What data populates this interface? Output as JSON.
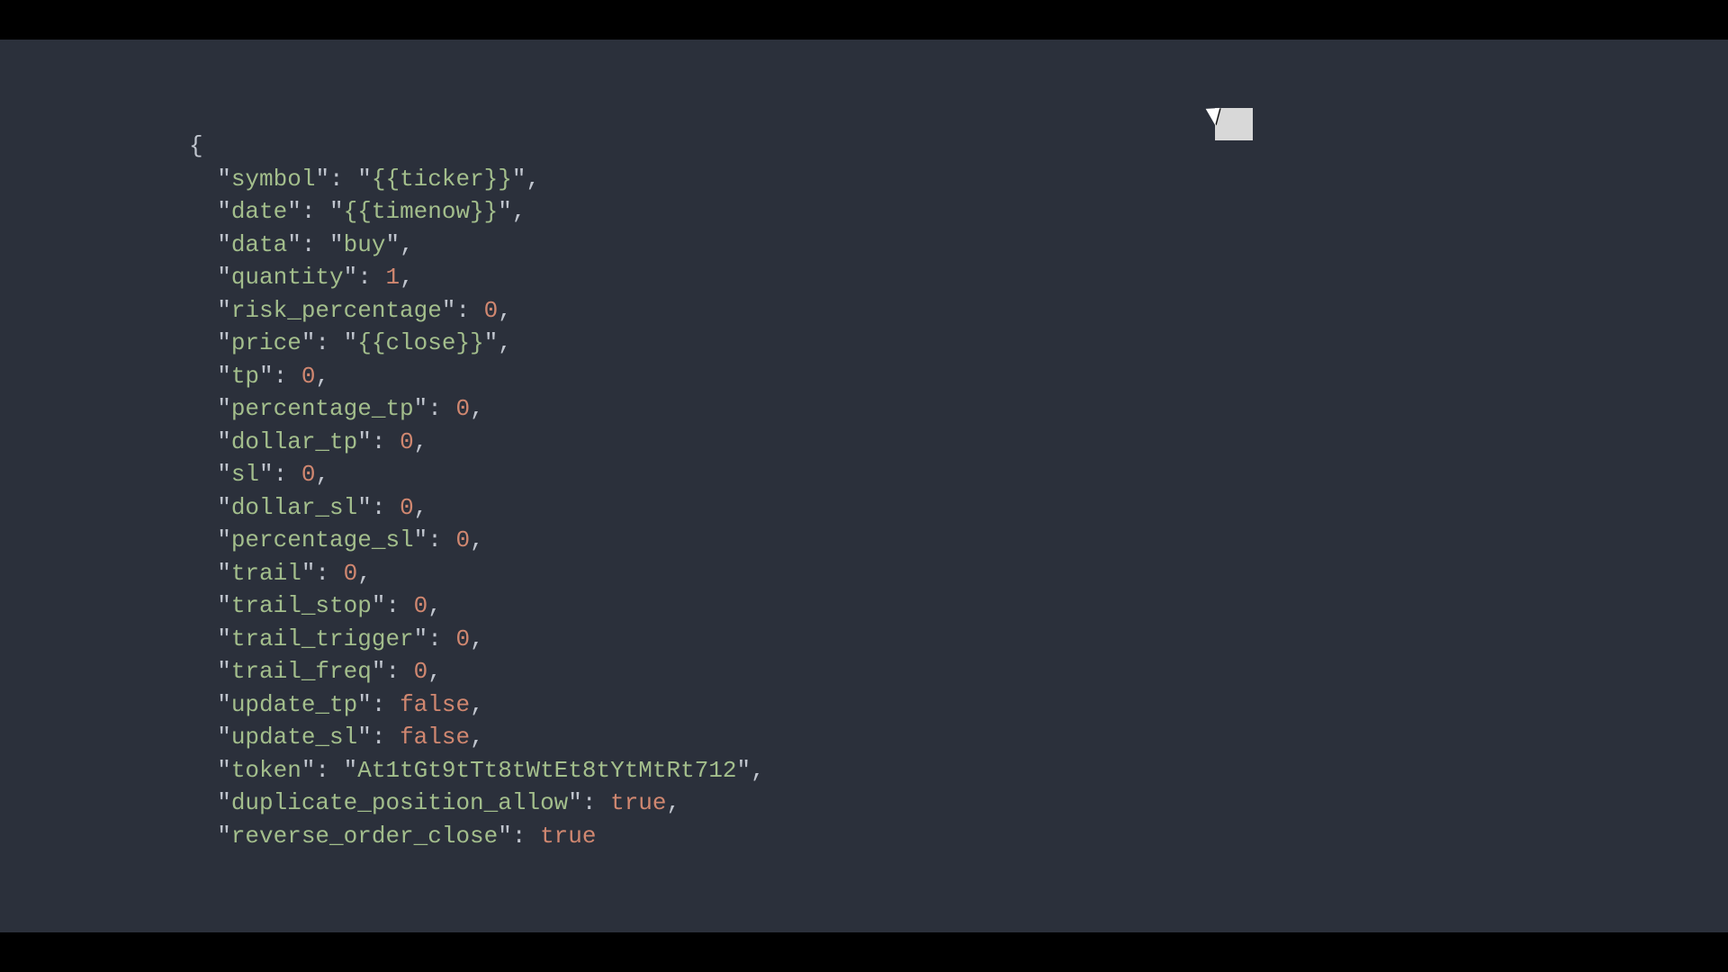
{
  "code": {
    "lines": [
      [
        {
          "t": "punct",
          "v": "{"
        }
      ],
      [
        {
          "t": "punct",
          "v": "  \""
        },
        {
          "t": "key",
          "v": "symbol"
        },
        {
          "t": "punct",
          "v": "\": \""
        },
        {
          "t": "str",
          "v": "{{ticker}}"
        },
        {
          "t": "punct",
          "v": "\","
        }
      ],
      [
        {
          "t": "punct",
          "v": "  \""
        },
        {
          "t": "key",
          "v": "date"
        },
        {
          "t": "punct",
          "v": "\": \""
        },
        {
          "t": "str",
          "v": "{{timenow}}"
        },
        {
          "t": "punct",
          "v": "\","
        }
      ],
      [
        {
          "t": "punct",
          "v": "  \""
        },
        {
          "t": "key",
          "v": "data"
        },
        {
          "t": "punct",
          "v": "\": \""
        },
        {
          "t": "str",
          "v": "buy"
        },
        {
          "t": "punct",
          "v": "\","
        }
      ],
      [
        {
          "t": "punct",
          "v": "  \""
        },
        {
          "t": "key",
          "v": "quantity"
        },
        {
          "t": "punct",
          "v": "\": "
        },
        {
          "t": "num",
          "v": "1"
        },
        {
          "t": "punct",
          "v": ","
        }
      ],
      [
        {
          "t": "punct",
          "v": "  \""
        },
        {
          "t": "key",
          "v": "risk_percentage"
        },
        {
          "t": "punct",
          "v": "\": "
        },
        {
          "t": "num",
          "v": "0"
        },
        {
          "t": "punct",
          "v": ","
        }
      ],
      [
        {
          "t": "punct",
          "v": "  \""
        },
        {
          "t": "key",
          "v": "price"
        },
        {
          "t": "punct",
          "v": "\": \""
        },
        {
          "t": "str",
          "v": "{{close}}"
        },
        {
          "t": "punct",
          "v": "\","
        }
      ],
      [
        {
          "t": "punct",
          "v": "  \""
        },
        {
          "t": "key",
          "v": "tp"
        },
        {
          "t": "punct",
          "v": "\": "
        },
        {
          "t": "num",
          "v": "0"
        },
        {
          "t": "punct",
          "v": ","
        }
      ],
      [
        {
          "t": "punct",
          "v": "  \""
        },
        {
          "t": "key",
          "v": "percentage_tp"
        },
        {
          "t": "punct",
          "v": "\": "
        },
        {
          "t": "num",
          "v": "0"
        },
        {
          "t": "punct",
          "v": ","
        }
      ],
      [
        {
          "t": "punct",
          "v": "  \""
        },
        {
          "t": "key",
          "v": "dollar_tp"
        },
        {
          "t": "punct",
          "v": "\": "
        },
        {
          "t": "num",
          "v": "0"
        },
        {
          "t": "punct",
          "v": ","
        }
      ],
      [
        {
          "t": "punct",
          "v": "  \""
        },
        {
          "t": "key",
          "v": "sl"
        },
        {
          "t": "punct",
          "v": "\": "
        },
        {
          "t": "num",
          "v": "0"
        },
        {
          "t": "punct",
          "v": ","
        }
      ],
      [
        {
          "t": "punct",
          "v": "  \""
        },
        {
          "t": "key",
          "v": "dollar_sl"
        },
        {
          "t": "punct",
          "v": "\": "
        },
        {
          "t": "num",
          "v": "0"
        },
        {
          "t": "punct",
          "v": ","
        }
      ],
      [
        {
          "t": "punct",
          "v": "  \""
        },
        {
          "t": "key",
          "v": "percentage_sl"
        },
        {
          "t": "punct",
          "v": "\": "
        },
        {
          "t": "num",
          "v": "0"
        },
        {
          "t": "punct",
          "v": ","
        }
      ],
      [
        {
          "t": "punct",
          "v": "  \""
        },
        {
          "t": "key",
          "v": "trail"
        },
        {
          "t": "punct",
          "v": "\": "
        },
        {
          "t": "num",
          "v": "0"
        },
        {
          "t": "punct",
          "v": ","
        }
      ],
      [
        {
          "t": "punct",
          "v": "  \""
        },
        {
          "t": "key",
          "v": "trail_stop"
        },
        {
          "t": "punct",
          "v": "\": "
        },
        {
          "t": "num",
          "v": "0"
        },
        {
          "t": "punct",
          "v": ","
        }
      ],
      [
        {
          "t": "punct",
          "v": "  \""
        },
        {
          "t": "key",
          "v": "trail_trigger"
        },
        {
          "t": "punct",
          "v": "\": "
        },
        {
          "t": "num",
          "v": "0"
        },
        {
          "t": "punct",
          "v": ","
        }
      ],
      [
        {
          "t": "punct",
          "v": "  \""
        },
        {
          "t": "key",
          "v": "trail_freq"
        },
        {
          "t": "punct",
          "v": "\": "
        },
        {
          "t": "num",
          "v": "0"
        },
        {
          "t": "punct",
          "v": ","
        }
      ],
      [
        {
          "t": "punct",
          "v": "  \""
        },
        {
          "t": "key",
          "v": "update_tp"
        },
        {
          "t": "punct",
          "v": "\": "
        },
        {
          "t": "bool",
          "v": "false"
        },
        {
          "t": "punct",
          "v": ","
        }
      ],
      [
        {
          "t": "punct",
          "v": "  \""
        },
        {
          "t": "key",
          "v": "update_sl"
        },
        {
          "t": "punct",
          "v": "\": "
        },
        {
          "t": "bool",
          "v": "false"
        },
        {
          "t": "punct",
          "v": ","
        }
      ],
      [
        {
          "t": "punct",
          "v": "  \""
        },
        {
          "t": "key",
          "v": "token"
        },
        {
          "t": "punct",
          "v": "\": \""
        },
        {
          "t": "str",
          "v": "At1tGt9tTt8tWtEt8tYtMtRt712"
        },
        {
          "t": "punct",
          "v": "\","
        }
      ],
      [
        {
          "t": "punct",
          "v": "  \""
        },
        {
          "t": "key",
          "v": "duplicate_position_allow"
        },
        {
          "t": "punct",
          "v": "\": "
        },
        {
          "t": "bool",
          "v": "true"
        },
        {
          "t": "punct",
          "v": ","
        }
      ],
      [
        {
          "t": "punct",
          "v": "  \""
        },
        {
          "t": "key",
          "v": "reverse_order_close"
        },
        {
          "t": "punct",
          "v": "\": "
        },
        {
          "t": "bool",
          "v": "true"
        }
      ]
    ]
  }
}
